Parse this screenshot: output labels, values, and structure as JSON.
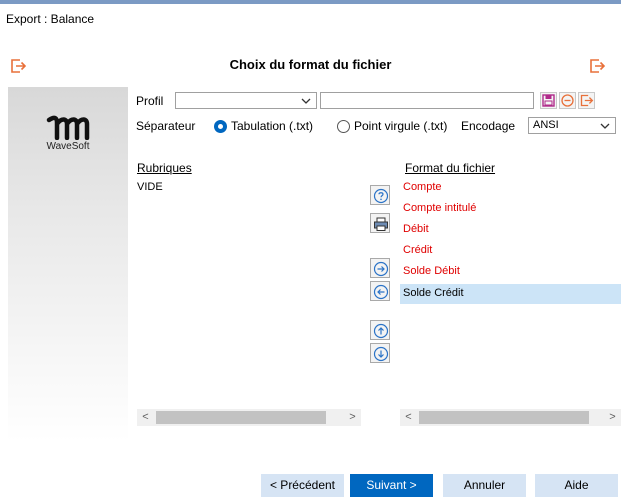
{
  "window": {
    "title": "Export : Balance"
  },
  "dialog": {
    "heading": "Choix du format du fichier"
  },
  "logo": {
    "text": "WaveSoft"
  },
  "profile": {
    "label": "Profil",
    "value": "",
    "name_value": ""
  },
  "separator": {
    "label": "Séparateur",
    "options": [
      "Tabulation (.txt)",
      "Point virgule (.txt)"
    ],
    "selected_index": 0
  },
  "encoding": {
    "label": "Encodage",
    "value": "ANSI"
  },
  "rubriques": {
    "header": "Rubriques",
    "items": [
      "VIDE"
    ]
  },
  "format": {
    "header": "Format du fichier",
    "items": [
      {
        "label": "Compte",
        "color": "#e00000"
      },
      {
        "label": "Compte intitulé",
        "color": "#e00000"
      },
      {
        "label": "Débit",
        "color": "#e00000"
      },
      {
        "label": "Crédit",
        "color": "#e00000"
      },
      {
        "label": "Solde Débit",
        "color": "#e00000"
      },
      {
        "label": "Solde Crédit",
        "color": "#000000"
      }
    ],
    "selected": "Solde Crédit"
  },
  "buttons": {
    "previous": "< Précédent",
    "next": "Suivant >",
    "cancel": "Annuler",
    "help": "Aide"
  },
  "colors": {
    "accent": "#0067c0",
    "required_field": "#e00000",
    "selection": "#cce4f7",
    "exit_icon": "#e8703a"
  },
  "icons": {
    "exit": "exit-door-icon",
    "save": "floppy-disk-icon",
    "delete": "minus-circle-icon",
    "help": "question-circle-icon",
    "print": "printer-icon",
    "add": "arrow-right-circle-icon",
    "remove": "arrow-left-circle-icon",
    "up": "arrow-up-circle-icon",
    "down": "arrow-down-circle-icon"
  }
}
